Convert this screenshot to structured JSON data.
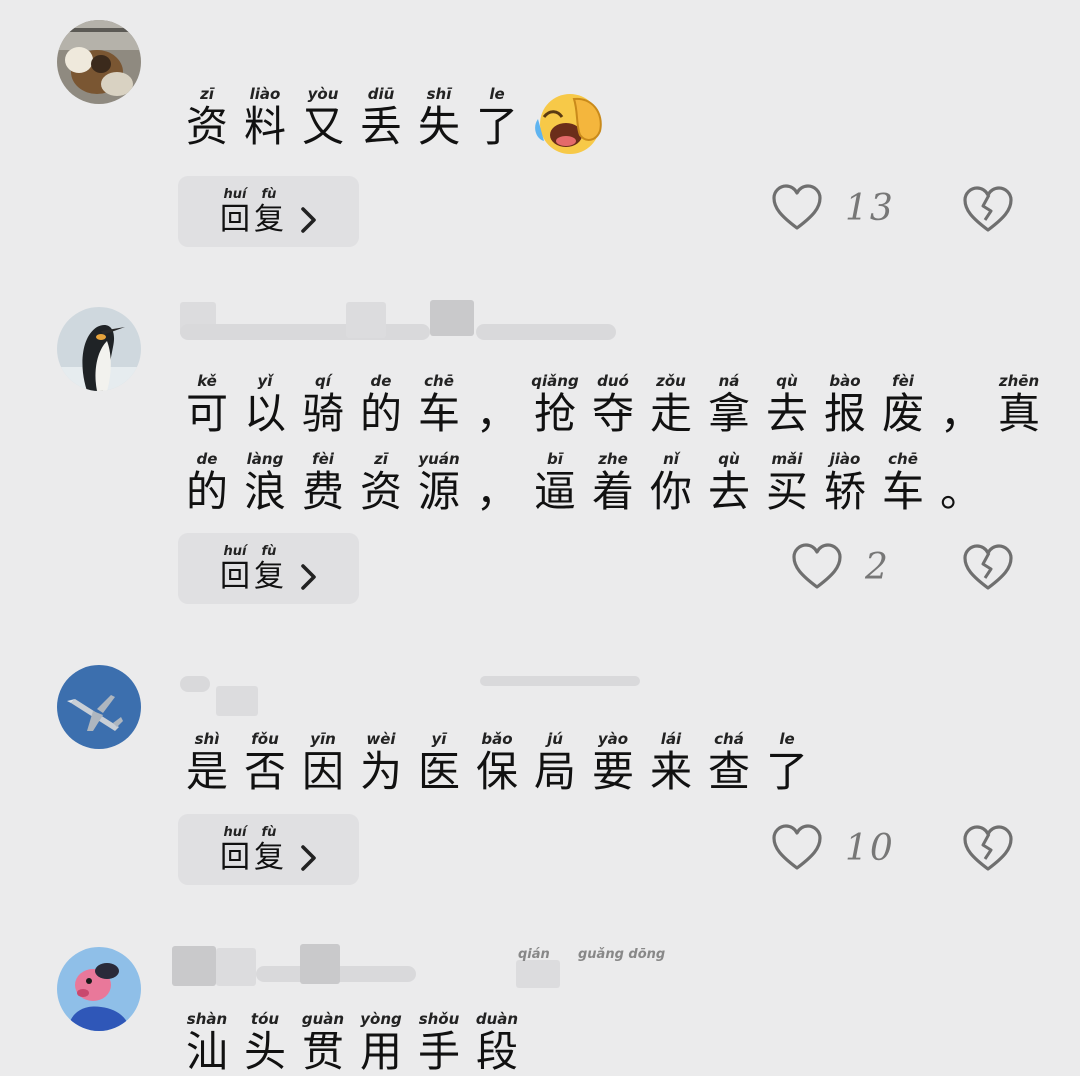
{
  "reply_button": {
    "pinyin": [
      "huí",
      "fù"
    ],
    "chars": [
      "回",
      "复"
    ]
  },
  "comments": [
    {
      "lines": [
        [
          [
            "zī",
            "资"
          ],
          [
            "liào",
            "料"
          ],
          [
            "yòu",
            "又"
          ],
          [
            "diū",
            "丢"
          ],
          [
            "shī",
            "失"
          ],
          [
            "le",
            "了"
          ]
        ]
      ],
      "emoji": "laughing-crying-emoji",
      "likes": "13"
    },
    {
      "lines": [
        [
          [
            "kě",
            "可"
          ],
          [
            "yǐ",
            "以"
          ],
          [
            "qí",
            "骑"
          ],
          [
            "de",
            "的"
          ],
          [
            "chē",
            "车"
          ],
          [
            "",
            "，"
          ],
          [
            "qiǎng",
            "抢"
          ],
          [
            "duó",
            "夺"
          ],
          [
            "zǒu",
            "走"
          ],
          [
            "ná",
            "拿"
          ],
          [
            "qù",
            "去"
          ],
          [
            "bào",
            "报"
          ],
          [
            "fèi",
            "废"
          ],
          [
            "",
            "，"
          ],
          [
            "zhēn",
            "真"
          ]
        ],
        [
          [
            "de",
            "的"
          ],
          [
            "làng",
            "浪"
          ],
          [
            "fèi",
            "费"
          ],
          [
            "zī",
            "资"
          ],
          [
            "yuán",
            "源"
          ],
          [
            "",
            "，"
          ],
          [
            "bī",
            "逼"
          ],
          [
            "zhe",
            "着"
          ],
          [
            "nǐ",
            "你"
          ],
          [
            "qù",
            "去"
          ],
          [
            "mǎi",
            "买"
          ],
          [
            "jiào",
            "轿"
          ],
          [
            "chē",
            "车"
          ],
          [
            "",
            "。"
          ]
        ]
      ],
      "likes": "2"
    },
    {
      "lines": [
        [
          [
            "shì",
            "是"
          ],
          [
            "fǒu",
            "否"
          ],
          [
            "yīn",
            "因"
          ],
          [
            "wèi",
            "为"
          ],
          [
            "yī",
            "医"
          ],
          [
            "bǎo",
            "保"
          ],
          [
            "jú",
            "局"
          ],
          [
            "yào",
            "要"
          ],
          [
            "lái",
            "来"
          ],
          [
            "chá",
            "查"
          ],
          [
            "le",
            "了"
          ]
        ]
      ],
      "likes": "10"
    },
    {
      "header_pinyin": [
        "qián",
        "guǎng dōng"
      ],
      "lines": [
        [
          [
            "shàn",
            "汕"
          ],
          [
            "tóu",
            "头"
          ],
          [
            "guàn",
            "贯"
          ],
          [
            "yòng",
            "用"
          ],
          [
            "shǒu",
            "手"
          ],
          [
            "duàn",
            "段"
          ]
        ]
      ]
    }
  ],
  "colors": {
    "background": "#ebebec",
    "button": "#e0e0e2",
    "icon": "#6f6f6f"
  }
}
